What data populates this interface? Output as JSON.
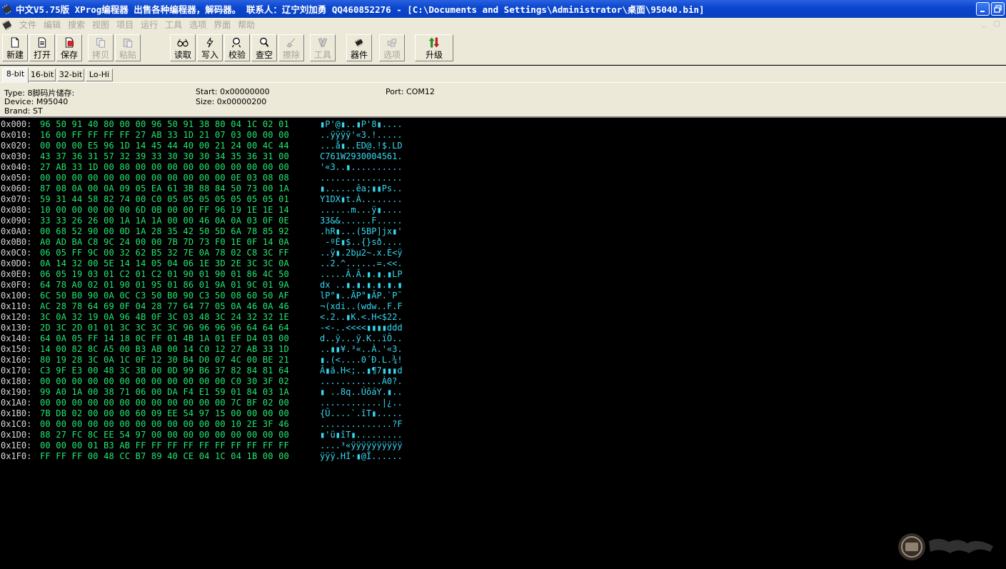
{
  "window": {
    "title": "中文V5.75版 XProg编程器 出售各种编程器，解码器。 联系人：辽宁刘加勇 QQ460852276 - [C:\\Documents and Settings\\Administrator\\桌面\\95040.bin]",
    "minimize": "_",
    "restore": "❐"
  },
  "menu": {
    "items": [
      "文件",
      "编辑",
      "搜索",
      "视图",
      "项目",
      "运行",
      "工具",
      "选项",
      "界面",
      "帮助"
    ],
    "mdi_controls": "_ □"
  },
  "toolbar": {
    "new": "新建",
    "open": "打开",
    "save": "保存",
    "copy": "拷贝",
    "paste": "粘贴",
    "read": "读取",
    "write": "写入",
    "verify": "校验",
    "blank": "查空",
    "erase": "擦除",
    "tools": "工具",
    "device": "器件",
    "options": "选项",
    "upgrade": "升级"
  },
  "tabs": [
    "8-bit",
    "16-bit",
    "32-bit",
    "Lo-Hi"
  ],
  "info": {
    "type": "Type: 8脚码片储存:",
    "device": "Device: M95040",
    "brand": "Brand: ST",
    "start": "Start: 0x00000000",
    "size": "Size: 0x00000200",
    "port": "Port: COM12"
  },
  "hex_rows": [
    {
      "addr": "0x000:",
      "bytes": "96 50 91 40 80 00 00 96 50 91 38 80 04 1C 02 01",
      "ascii": "▮P'@▮..▮P'8▮...."
    },
    {
      "addr": "0x010:",
      "bytes": "16 00 FF FF FF FF 27 AB 33 1D 21 07 03 00 00 00",
      "ascii": "..ÿÿÿÿ'«3.!....."
    },
    {
      "addr": "0x020:",
      "bytes": "00 00 00 E5 96 1D 14 45 44 40 00 21 24 00 4C 44",
      "ascii": "...å▮..ED@.!$.LD"
    },
    {
      "addr": "0x030:",
      "bytes": "43 37 36 31 57 32 39 33 30 30 30 34 35 36 31 00",
      "ascii": "C761W2930004561."
    },
    {
      "addr": "0x040:",
      "bytes": "27 AB 33 1D 00 80 00 00 00 00 00 00 00 00 00 00",
      "ascii": "'«3..▮.........."
    },
    {
      "addr": "0x050:",
      "bytes": "00 00 00 00 00 00 00 00 00 00 00 00 0E 03 08 08",
      "ascii": "................"
    },
    {
      "addr": "0x060:",
      "bytes": "87 08 0A 00 0A 09 05 EA 61 3B 88 84 50 73 00 1A",
      "ascii": "▮......êa;▮▮Ps.."
    },
    {
      "addr": "0x070:",
      "bytes": "59 31 44 58 82 74 00 C0 05 05 05 05 05 05 05 01",
      "ascii": "Y1DX▮t.À........"
    },
    {
      "addr": "0x080:",
      "bytes": "10 00 00 00 00 00 6D 0B 00 00 FF 96 19 1E 1E 14",
      "ascii": "......m...ÿ▮...."
    },
    {
      "addr": "0x090:",
      "bytes": "33 33 26 26 00 1A 1A 1A 00 00 46 0A 0A 03 0F 0E",
      "ascii": "33&&......F....."
    },
    {
      "addr": "0x0A0:",
      "bytes": "00 68 52 90 00 0D 1A 28 35 42 50 5D 6A 78 85 92",
      "ascii": ".hR▮...(5BP]jx▮'"
    },
    {
      "addr": "0x0B0:",
      "bytes": "A0 AD BA C8 9C 24 00 00 7B 7D 73 F0 1E 0F 14 0A",
      "ascii": " -ºÈ▮$..{}sð...."
    },
    {
      "addr": "0x0C0:",
      "bytes": "06 05 FF 9C 00 32 62 B5 32 7E 0A 78 02 C8 3C FF",
      "ascii": "..ÿ▮.2bµ2~.x.È<ÿ"
    },
    {
      "addr": "0x0D0:",
      "bytes": "0A 14 32 00 5E 14 14 05 04 06 1E 3D 2E 3C 3C 0A",
      "ascii": "..2.^......=.<<."
    },
    {
      "addr": "0x0E0:",
      "bytes": "06 05 19 03 01 C2 01 C2 01 90 01 90 01 86 4C 50",
      "ascii": ".....Â.Â.▮.▮.▮LP"
    },
    {
      "addr": "0x0F0:",
      "bytes": "64 78 A0 02 01 90 01 95 01 86 01 9A 01 9C 01 9A",
      "ascii": "dx ..▮.▮.▮.▮.▮.▮"
    },
    {
      "addr": "0x100:",
      "bytes": "6C 50 B0 90 0A 0C C3 50 B0 90 C3 50 08 60 50 AF",
      "ascii": "lP°▮..ÃP°▮ÃP.`P¯"
    },
    {
      "addr": "0x110:",
      "bytes": "AC 28 78 64 69 0F 04 28 77 64 77 05 0A 46 0A 46",
      "ascii": "¬(xdi..(wdw..F.F"
    },
    {
      "addr": "0x120:",
      "bytes": "3C 0A 32 19 0A 96 4B 0F 3C 03 48 3C 24 32 32 1E",
      "ascii": "<.2..▮K.<.H<$22."
    },
    {
      "addr": "0x130:",
      "bytes": "2D 3C 2D 01 01 3C 3C 3C 3C 96 96 96 96 64 64 64",
      "ascii": "-<-..<<<<▮▮▮▮ddd"
    },
    {
      "addr": "0x140:",
      "bytes": "64 0A 05 FF 14 18 0C FF 01 4B 1A 01 EF D4 03 00",
      "ascii": "d..ÿ...ÿ.K..ïÔ.."
    },
    {
      "addr": "0x150:",
      "bytes": "14 00 82 8C A5 00 B3 AB 00 14 C0 12 27 AB 33 1D",
      "ascii": "..▮▮¥.³«..À.'«3."
    },
    {
      "addr": "0x160:",
      "bytes": "80 19 28 3C 0A 1C 0F 12 30 B4 D0 07 4C 00 BE 21",
      "ascii": "▮.(<....0´Ð.L.¾!"
    },
    {
      "addr": "0x170:",
      "bytes": "C3 9F E3 00 48 3C 3B 00 0D 99 B6 37 82 84 81 64",
      "ascii": "Ã▮ã.H<;..▮¶7▮▮▮d"
    },
    {
      "addr": "0x180:",
      "bytes": "00 00 00 00 00 00 00 00 00 00 00 00 C0 30 3F 02",
      "ascii": "............À0?."
    },
    {
      "addr": "0x190:",
      "bytes": "99 A0 1A 00 38 71 06 00 DA F4 E1 59 01 84 03 1A",
      "ascii": "▮ ..8q..ÚôáY.▮.."
    },
    {
      "addr": "0x1A0:",
      "bytes": "00 00 00 00 00 00 00 00 00 00 00 00 7C BF 02 00",
      "ascii": "............|¿.."
    },
    {
      "addr": "0x1B0:",
      "bytes": "7B DB 02 00 00 00 60 09 EE 54 97 15 00 00 00 00",
      "ascii": "{Û....`.îT▮....."
    },
    {
      "addr": "0x1C0:",
      "bytes": "00 00 00 00 00 00 00 00 00 00 00 00 10 2E 3F 46",
      "ascii": "..............?F"
    },
    {
      "addr": "0x1D0:",
      "bytes": "88 27 FC 8C EE 54 97 00 00 00 00 00 00 00 00 00",
      "ascii": "▮'ü▮îT▮........."
    },
    {
      "addr": "0x1E0:",
      "bytes": "00 00 00 01 B3 AB FF FF FF FF FF FF FF FF FF FF",
      "ascii": "....³«ÿÿÿÿÿÿÿÿÿÿ"
    },
    {
      "addr": "0x1F0:",
      "bytes": "FF FF FF 00 48 CC B7 89 40 CE 04 1C 04 1B 00 00",
      "ascii": "ÿÿÿ.HÌ·▮@Î......"
    }
  ],
  "colors": {
    "address": "#d8d8d8",
    "bytes": "#21e86f",
    "ascii": "#35d8f0",
    "background": "#000000"
  }
}
